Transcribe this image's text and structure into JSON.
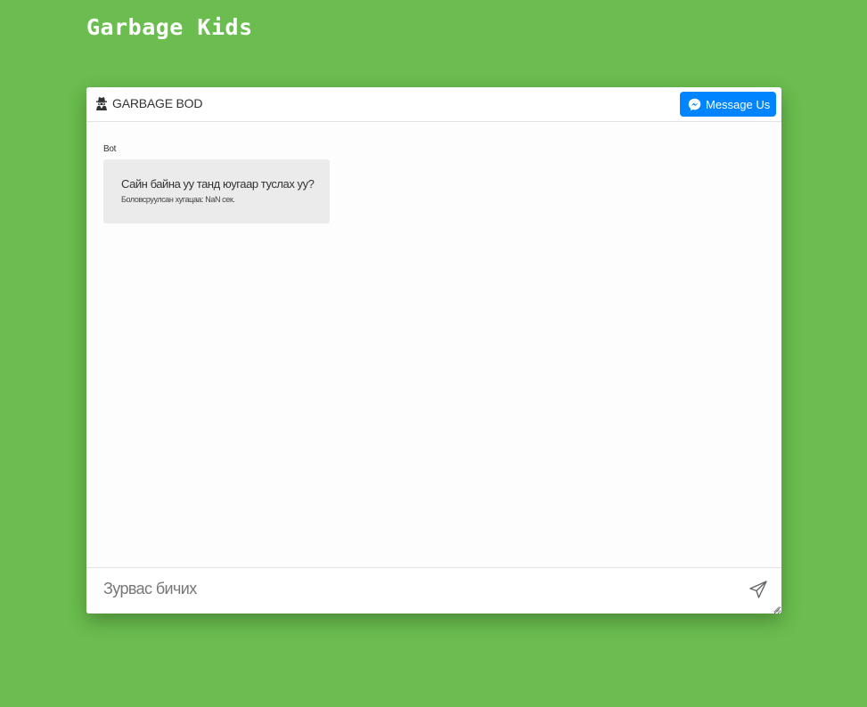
{
  "site": {
    "title": "Garbage Kids"
  },
  "chat": {
    "bot_name": "GARBAGE BOD",
    "bot_icon": "user-secret-icon",
    "messenger_button_label": "Message Us",
    "messenger_color": "#0084ff",
    "messages": [
      {
        "sender": "Bot",
        "text": "Сайн байна уу танд юугаар туслах уу?",
        "meta": "Боловсруулсан хугацаа: NaN сек."
      }
    ],
    "input": {
      "placeholder": "Зурвас бичих",
      "value": ""
    },
    "send_icon": "paper-plane-icon"
  },
  "colors": {
    "background": "#6abd4e",
    "panel": "#fdfdfd",
    "bubble": "#ebebeb"
  }
}
